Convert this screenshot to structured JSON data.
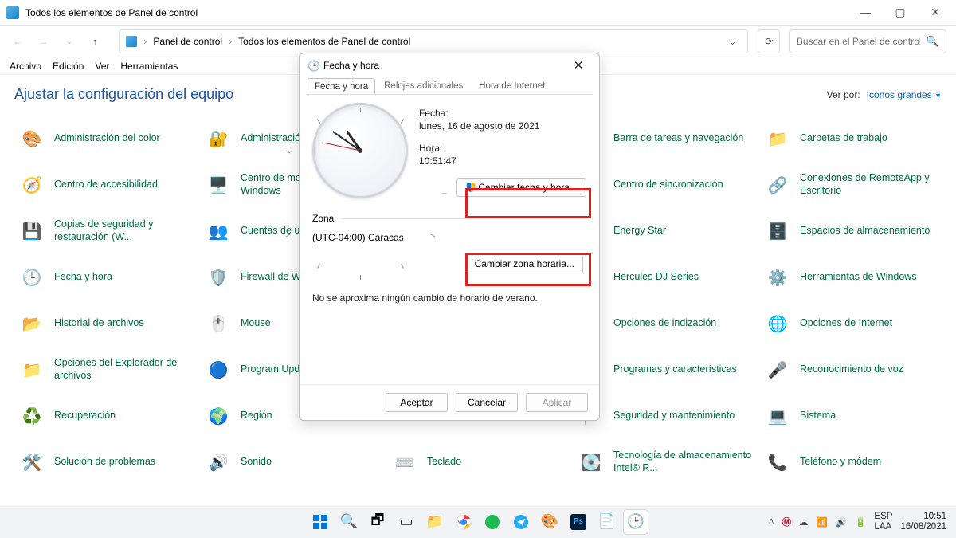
{
  "window": {
    "title": "Todos los elementos de Panel de control",
    "breadcrumb": [
      "Panel de control",
      "Todos los elementos de Panel de control"
    ]
  },
  "search": {
    "placeholder": "Buscar en el Panel de control"
  },
  "menubar": [
    "Archivo",
    "Edición",
    "Ver",
    "Herramientas"
  ],
  "content": {
    "title": "Ajustar la configuración del equipo",
    "viewby_label": "Ver por:",
    "viewby_value": "Iconos grandes"
  },
  "items": [
    {
      "label": "Administración del color",
      "icon": "🎨"
    },
    {
      "label": "Administración de credenciales",
      "icon": "🔐"
    },
    {
      "label": "",
      "icon": ""
    },
    {
      "label": "Barra de tareas y navegación",
      "icon": "🗔"
    },
    {
      "label": "Carpetas de trabajo",
      "icon": "📁"
    },
    {
      "label": "Centro de accesibilidad",
      "icon": "🧭"
    },
    {
      "label": "Centro de movilidad de Windows",
      "icon": "🖥️"
    },
    {
      "label": "",
      "icon": ""
    },
    {
      "label": "Centro de sincronización",
      "icon": "🔄"
    },
    {
      "label": "Conexiones de RemoteApp y Escritorio",
      "icon": "🔗"
    },
    {
      "label": "Copias de seguridad y restauración (W...",
      "icon": "💾"
    },
    {
      "label": "Cuentas de usuario",
      "icon": "👥"
    },
    {
      "label": "",
      "icon": ""
    },
    {
      "label": "Energy Star",
      "icon": "⭐"
    },
    {
      "label": "Espacios de almacenamiento",
      "icon": "🗄️"
    },
    {
      "label": "Fecha y hora",
      "icon": "🕒"
    },
    {
      "label": "Firewall de Windows Defender",
      "icon": "🛡️"
    },
    {
      "label": "",
      "icon": ""
    },
    {
      "label": "Hercules DJ Series",
      "icon": "🎛️"
    },
    {
      "label": "Herramientas de Windows",
      "icon": "⚙️"
    },
    {
      "label": "Historial de archivos",
      "icon": "📂"
    },
    {
      "label": "Mouse",
      "icon": "🖱️"
    },
    {
      "label": "",
      "icon": ""
    },
    {
      "label": "Opciones de indización",
      "icon": "🔍"
    },
    {
      "label": "Opciones de Internet",
      "icon": "🌐"
    },
    {
      "label": "Opciones del Explorador de archivos",
      "icon": "📁"
    },
    {
      "label": "Program Updates",
      "icon": "🔵"
    },
    {
      "label": "",
      "icon": ""
    },
    {
      "label": "Programas y características",
      "icon": "📦"
    },
    {
      "label": "Reconocimiento de voz",
      "icon": "🎤"
    },
    {
      "label": "Recuperación",
      "icon": "♻️"
    },
    {
      "label": "Región",
      "icon": "🌍"
    },
    {
      "label": "",
      "icon": ""
    },
    {
      "label": "Seguridad y mantenimiento",
      "icon": "🏳️"
    },
    {
      "label": "Sistema",
      "icon": "💻"
    },
    {
      "label": "Solución de problemas",
      "icon": "🛠️"
    },
    {
      "label": "Sonido",
      "icon": "🔊"
    },
    {
      "label": "Teclado",
      "icon": "⌨️"
    },
    {
      "label": "Tecnología de almacenamiento Intel® R...",
      "icon": "💽"
    },
    {
      "label": "Teléfono y módem",
      "icon": "📞"
    }
  ],
  "dialog": {
    "title": "Fecha y hora",
    "tabs": [
      "Fecha y hora",
      "Relojes adicionales",
      "Hora de Internet"
    ],
    "date_label": "Fecha:",
    "date_value": "lunes, 16 de agosto de 2021",
    "time_label": "Hora:",
    "time_value": "10:51:47",
    "change_dt": "Cambiar fecha y hora...",
    "zone_label": "Zona",
    "zone_value": "(UTC-04:00) Caracas",
    "change_tz": "Cambiar zona horaria...",
    "dst_note": "No se aproxima ningún cambio de horario de verano.",
    "btn_ok": "Aceptar",
    "btn_cancel": "Cancelar",
    "btn_apply": "Aplicar"
  },
  "taskbar": {
    "lang1": "ESP",
    "lang2": "LAA",
    "time": "10:51",
    "date": "16/08/2021"
  }
}
